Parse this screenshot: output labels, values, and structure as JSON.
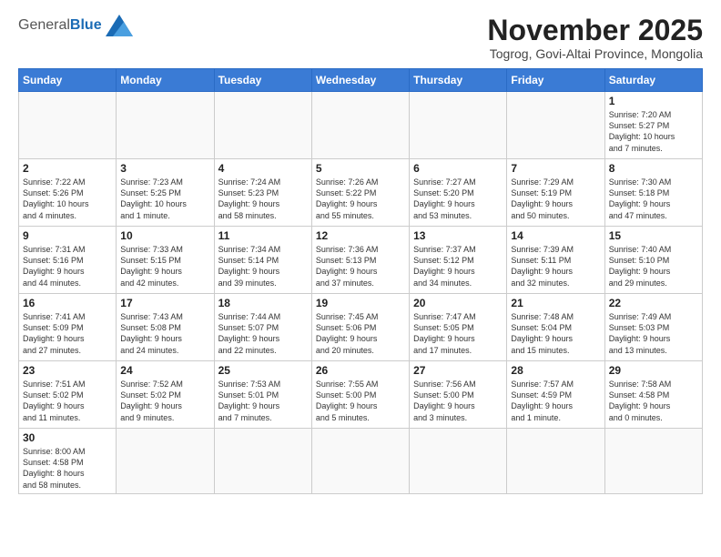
{
  "logo": {
    "general": "General",
    "blue": "Blue"
  },
  "title": "November 2025",
  "subtitle": "Togrog, Govi-Altai Province, Mongolia",
  "weekdays": [
    "Sunday",
    "Monday",
    "Tuesday",
    "Wednesday",
    "Thursday",
    "Friday",
    "Saturday"
  ],
  "weeks": [
    [
      {
        "day": "",
        "info": ""
      },
      {
        "day": "",
        "info": ""
      },
      {
        "day": "",
        "info": ""
      },
      {
        "day": "",
        "info": ""
      },
      {
        "day": "",
        "info": ""
      },
      {
        "day": "",
        "info": ""
      },
      {
        "day": "1",
        "info": "Sunrise: 7:20 AM\nSunset: 5:27 PM\nDaylight: 10 hours\nand 7 minutes."
      }
    ],
    [
      {
        "day": "2",
        "info": "Sunrise: 7:22 AM\nSunset: 5:26 PM\nDaylight: 10 hours\nand 4 minutes."
      },
      {
        "day": "3",
        "info": "Sunrise: 7:23 AM\nSunset: 5:25 PM\nDaylight: 10 hours\nand 1 minute."
      },
      {
        "day": "4",
        "info": "Sunrise: 7:24 AM\nSunset: 5:23 PM\nDaylight: 9 hours\nand 58 minutes."
      },
      {
        "day": "5",
        "info": "Sunrise: 7:26 AM\nSunset: 5:22 PM\nDaylight: 9 hours\nand 55 minutes."
      },
      {
        "day": "6",
        "info": "Sunrise: 7:27 AM\nSunset: 5:20 PM\nDaylight: 9 hours\nand 53 minutes."
      },
      {
        "day": "7",
        "info": "Sunrise: 7:29 AM\nSunset: 5:19 PM\nDaylight: 9 hours\nand 50 minutes."
      },
      {
        "day": "8",
        "info": "Sunrise: 7:30 AM\nSunset: 5:18 PM\nDaylight: 9 hours\nand 47 minutes."
      }
    ],
    [
      {
        "day": "9",
        "info": "Sunrise: 7:31 AM\nSunset: 5:16 PM\nDaylight: 9 hours\nand 44 minutes."
      },
      {
        "day": "10",
        "info": "Sunrise: 7:33 AM\nSunset: 5:15 PM\nDaylight: 9 hours\nand 42 minutes."
      },
      {
        "day": "11",
        "info": "Sunrise: 7:34 AM\nSunset: 5:14 PM\nDaylight: 9 hours\nand 39 minutes."
      },
      {
        "day": "12",
        "info": "Sunrise: 7:36 AM\nSunset: 5:13 PM\nDaylight: 9 hours\nand 37 minutes."
      },
      {
        "day": "13",
        "info": "Sunrise: 7:37 AM\nSunset: 5:12 PM\nDaylight: 9 hours\nand 34 minutes."
      },
      {
        "day": "14",
        "info": "Sunrise: 7:39 AM\nSunset: 5:11 PM\nDaylight: 9 hours\nand 32 minutes."
      },
      {
        "day": "15",
        "info": "Sunrise: 7:40 AM\nSunset: 5:10 PM\nDaylight: 9 hours\nand 29 minutes."
      }
    ],
    [
      {
        "day": "16",
        "info": "Sunrise: 7:41 AM\nSunset: 5:09 PM\nDaylight: 9 hours\nand 27 minutes."
      },
      {
        "day": "17",
        "info": "Sunrise: 7:43 AM\nSunset: 5:08 PM\nDaylight: 9 hours\nand 24 minutes."
      },
      {
        "day": "18",
        "info": "Sunrise: 7:44 AM\nSunset: 5:07 PM\nDaylight: 9 hours\nand 22 minutes."
      },
      {
        "day": "19",
        "info": "Sunrise: 7:45 AM\nSunset: 5:06 PM\nDaylight: 9 hours\nand 20 minutes."
      },
      {
        "day": "20",
        "info": "Sunrise: 7:47 AM\nSunset: 5:05 PM\nDaylight: 9 hours\nand 17 minutes."
      },
      {
        "day": "21",
        "info": "Sunrise: 7:48 AM\nSunset: 5:04 PM\nDaylight: 9 hours\nand 15 minutes."
      },
      {
        "day": "22",
        "info": "Sunrise: 7:49 AM\nSunset: 5:03 PM\nDaylight: 9 hours\nand 13 minutes."
      }
    ],
    [
      {
        "day": "23",
        "info": "Sunrise: 7:51 AM\nSunset: 5:02 PM\nDaylight: 9 hours\nand 11 minutes."
      },
      {
        "day": "24",
        "info": "Sunrise: 7:52 AM\nSunset: 5:02 PM\nDaylight: 9 hours\nand 9 minutes."
      },
      {
        "day": "25",
        "info": "Sunrise: 7:53 AM\nSunset: 5:01 PM\nDaylight: 9 hours\nand 7 minutes."
      },
      {
        "day": "26",
        "info": "Sunrise: 7:55 AM\nSunset: 5:00 PM\nDaylight: 9 hours\nand 5 minutes."
      },
      {
        "day": "27",
        "info": "Sunrise: 7:56 AM\nSunset: 5:00 PM\nDaylight: 9 hours\nand 3 minutes."
      },
      {
        "day": "28",
        "info": "Sunrise: 7:57 AM\nSunset: 4:59 PM\nDaylight: 9 hours\nand 1 minute."
      },
      {
        "day": "29",
        "info": "Sunrise: 7:58 AM\nSunset: 4:58 PM\nDaylight: 9 hours\nand 0 minutes."
      }
    ],
    [
      {
        "day": "30",
        "info": "Sunrise: 8:00 AM\nSunset: 4:58 PM\nDaylight: 8 hours\nand 58 minutes."
      },
      {
        "day": "",
        "info": ""
      },
      {
        "day": "",
        "info": ""
      },
      {
        "day": "",
        "info": ""
      },
      {
        "day": "",
        "info": ""
      },
      {
        "day": "",
        "info": ""
      },
      {
        "day": "",
        "info": ""
      }
    ]
  ]
}
